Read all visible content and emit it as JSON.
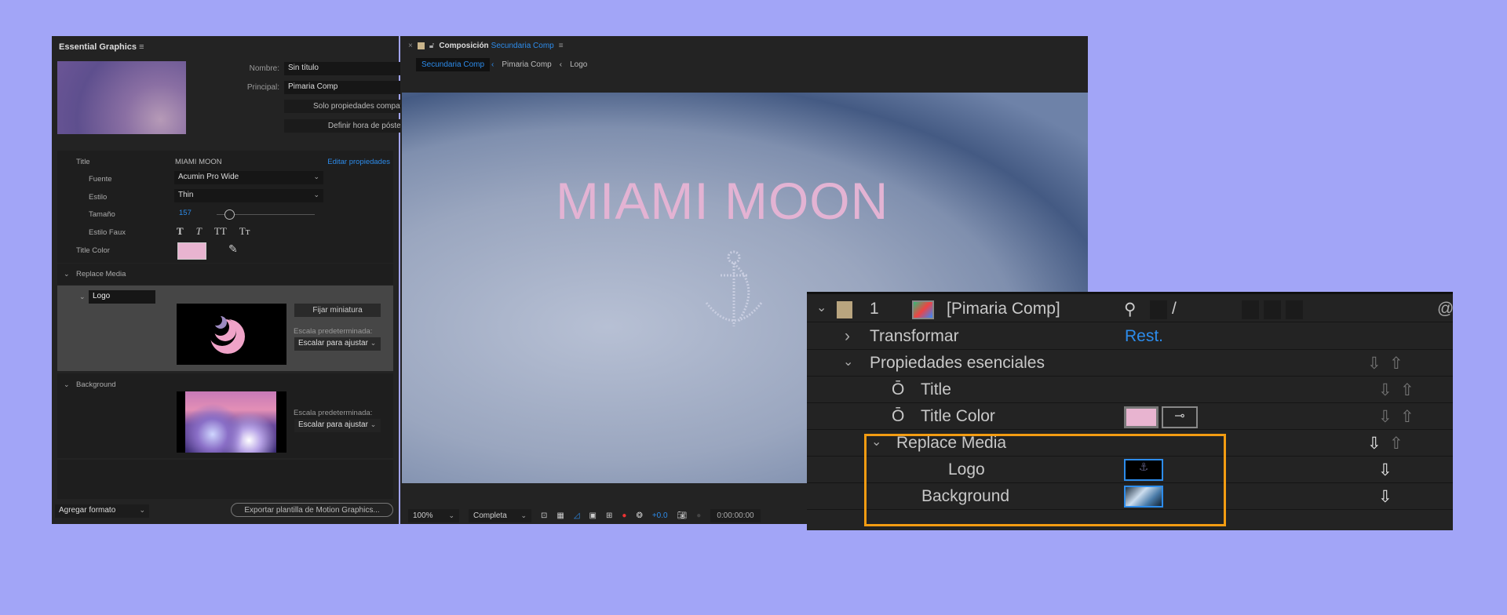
{
  "essential_graphics": {
    "title": "Essential Graphics",
    "menu_icon": "hamburger-icon",
    "nombre_label": "Nombre:",
    "nombre_value": "Sin título",
    "principal_label": "Principal:",
    "principal_value": "Pimaria Comp",
    "solo_button": "Solo propiedades compatibles",
    "poster_button": "Definir hora de póster",
    "title_label": "Title",
    "title_value": "MIAMI MOON",
    "edit_link": "Editar propiedades",
    "fuente_label": "Fuente",
    "fuente_value": "Acumin Pro Wide",
    "estilo_label": "Estilo",
    "estilo_value": "Thin",
    "tamano_label": "Tamaño",
    "tamano_value": "157",
    "faux_label": "Estilo Faux",
    "faux_buttons": [
      "T",
      "T",
      "TT",
      "Tт"
    ],
    "title_color_label": "Title Color",
    "title_color": "#e8b4d0",
    "replace_media_label": "Replace Media",
    "logo_name": "Logo",
    "fijar_button": "Fijar miniatura",
    "escala_label": "Escala predeterminada:",
    "escala_value": "Escalar para ajustar",
    "background_label": "Background",
    "agregar_formato": "Agregar formato",
    "export_button": "Exportar plantilla de Motion Graphics..."
  },
  "composition": {
    "tab_prefix": "Composición",
    "tab_name": "Secundaria Comp",
    "breadcrumbs": [
      "Secundaria Comp",
      "Pimaria Comp",
      "Logo"
    ],
    "viewer_text": "MIAMI MOON",
    "zoom": "100%",
    "resolution": "Completa",
    "exposure": "+0.0",
    "timecode": "0:00:00:00"
  },
  "timeline": {
    "layer_number": "1",
    "layer_name": "[Pimaria Comp]",
    "label_color": "#b9a57f",
    "transform": "Transformar",
    "reset": "Rest.",
    "essential": "Propiedades esenciales",
    "title": "Title",
    "title_color": "Title Color",
    "replace_media": "Replace Media",
    "logo": "Logo",
    "background": "Background",
    "highlight_color": "#f39c12"
  }
}
